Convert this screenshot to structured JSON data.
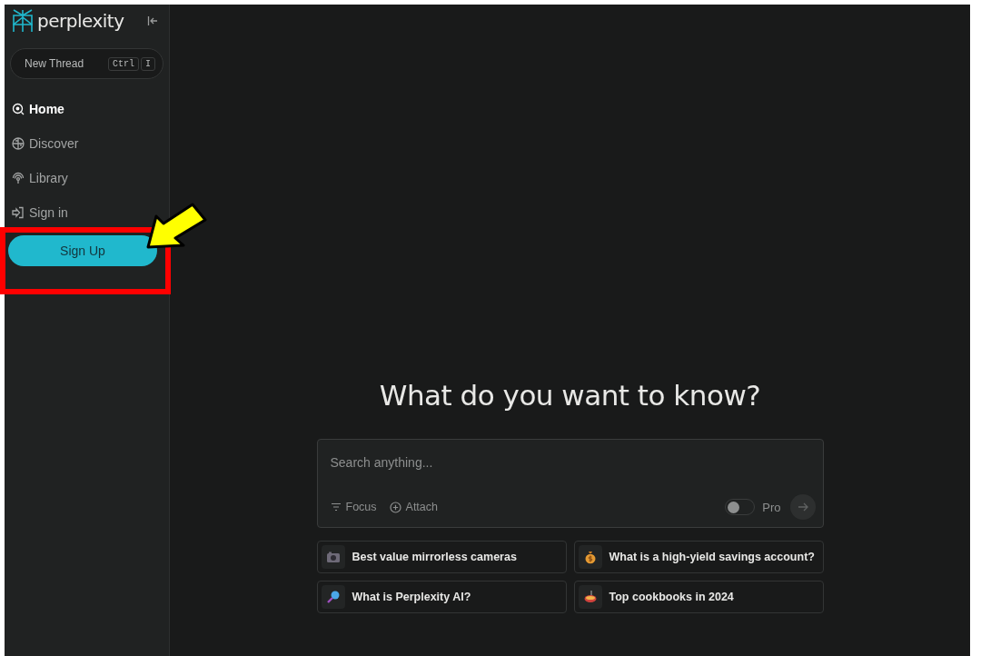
{
  "brand": "perplexity",
  "new_thread": {
    "label": "New Thread",
    "keys": [
      "Ctrl",
      "I"
    ]
  },
  "nav": [
    {
      "label": "Home",
      "kind": "search",
      "selected": true
    },
    {
      "label": "Discover",
      "kind": "globe",
      "selected": false
    },
    {
      "label": "Library",
      "kind": "library",
      "selected": false
    },
    {
      "label": "Sign in",
      "kind": "signin",
      "selected": false
    }
  ],
  "signup": "Sign Up",
  "heading": "What do you want to know?",
  "search": {
    "placeholder": "Search anything...",
    "focus": "Focus",
    "attach": "Attach",
    "pro_label": "Pro",
    "pro_on": false
  },
  "suggestions": [
    {
      "kind": "camera",
      "text": "Best value mirrorless cameras"
    },
    {
      "kind": "moneybag",
      "text": "What is a high-yield savings account?"
    },
    {
      "kind": "magnifier",
      "text": "What is Perplexity AI?"
    },
    {
      "kind": "pot",
      "text": "Top cookbooks in 2024"
    }
  ]
}
